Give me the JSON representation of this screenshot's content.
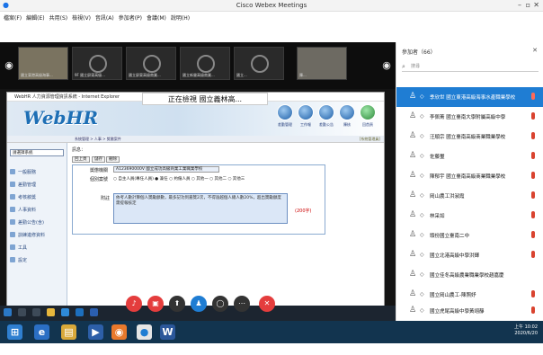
{
  "window": {
    "title": "Cisco Webex Meetings"
  },
  "menu": [
    "檔案(F)",
    "編輯(E)",
    "共用(S)",
    "檢視(V)",
    "音訊(A)",
    "參加者(P)",
    "會議(M)",
    "說明(H)"
  ],
  "video_strip": {
    "thumbs": [
      {
        "caption": "國立東港高級海事..."
      },
      {
        "caption": "9F 國立屏東高級..."
      },
      {
        "caption": "國立屏東高級商業..."
      },
      {
        "caption": "國立新營高級商業..."
      },
      {
        "caption": "國立..."
      },
      {
        "caption": "陳..."
      }
    ]
  },
  "ie": {
    "title": "WebHR 人力資源管理資訊系統 - Internet Explorer",
    "viewing": "正在檢視 國立義林高...",
    "logo": "WebHR",
    "crumb_left": "系統管理 > 人事 > 獎懲案件",
    "crumb_right": "[系統管理員]",
    "modules": [
      "差勤管理",
      "工作報",
      "差勤公告",
      "陳核",
      "回首頁"
    ],
    "system_select": "請選擇系統",
    "sidebar": [
      "一般服務",
      "差勤管理",
      "考核敘獎",
      "人事資料",
      "差勤公告(含)",
      "訓練進修資料",
      "工具",
      "設定"
    ],
    "content": {
      "page_label": "訊息：",
      "tabs": [
        "回上頁",
        "儲存",
        "刪除"
      ],
      "field1_label": "獎懲機關",
      "field1_value": "A123690000V 國立成功高級商業工業職業學校",
      "field2_label": "個別案號",
      "radio_text": "○ 自主人員(專任人員)  ● 兼任 ○ 約僱人員 ○ 其他一 ○ 其他二 ○ 其他三",
      "note_label": "附註",
      "note_text": "依考人數計算個人獎勵額數，最多記功到嘉獎2次，不得逾越個人總人數20%，超出獎勵額度需提報核定",
      "counter": "(200字)"
    }
  },
  "panel": {
    "title": "參加者（66）",
    "search_placeholder": "搜尋",
    "participants": [
      {
        "name": "季欣世 國立東港高級海事水產職業學校",
        "selected": true
      },
      {
        "name": "李佩菁 國立臺南大學附屬高級中學",
        "selected": false
      },
      {
        "name": "汪順宗 國立臺南高級商業職業學校",
        "selected": false
      },
      {
        "name": "佐藤璽",
        "selected": false
      },
      {
        "name": "陳郁宇 國立臺南高級商業職業學校",
        "selected": false
      },
      {
        "name": "岡山農工洪淑霞",
        "selected": false
      },
      {
        "name": "林采如",
        "selected": false
      },
      {
        "name": "頭份國立臺南二中",
        "selected": false
      },
      {
        "name": "國立北港高級中學洪輝",
        "selected": false
      },
      {
        "name": "國立佳冬高級農業職業學校趙嘉慶",
        "selected": false
      },
      {
        "name": "國立岡山農工-陳照妤",
        "selected": false
      },
      {
        "name": "國立虎尾高級中學黃翊靜",
        "selected": false
      },
      {
        "name": "國立屏東女中 蔡秀霞",
        "selected": false
      }
    ]
  },
  "taskbar": {
    "time": "上午 10:02",
    "date": "2020/6/20"
  },
  "colors": {
    "selected_row": "#1f7dd3",
    "call_end": "#e43d3d",
    "stage": "#141414"
  }
}
